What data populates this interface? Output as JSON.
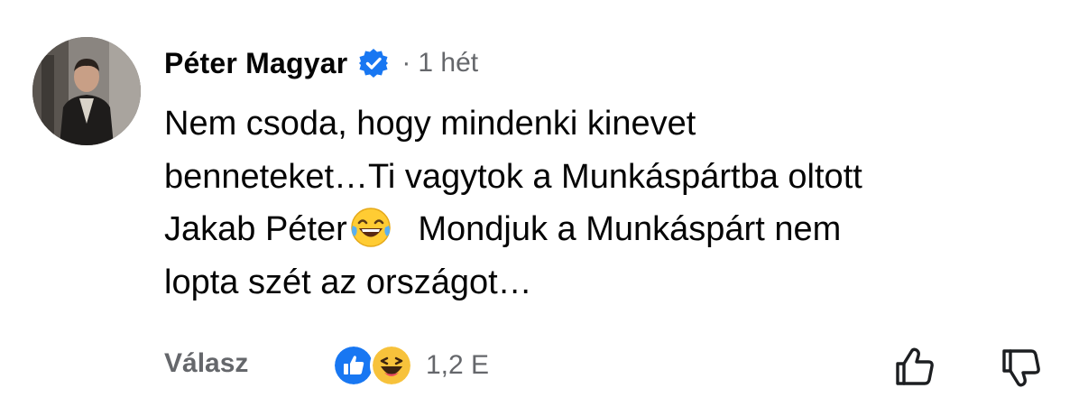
{
  "comment": {
    "author": "Péter Magyar",
    "time_separator": "·",
    "time": "1 hét",
    "text_lines": [
      "Nem csoda, hogy mindenki kinevet",
      "benneteket…Ti vagytok a Munkáspártba oltott",
      "Jakab Péter",
      " Mondjuk a Munkáspárt nem",
      "lopta szét az országot…"
    ],
    "inline_emoji": "face-with-tears-of-joy",
    "reply_label": "Válasz",
    "reaction_icons": [
      "like-reaction",
      "haha-reaction"
    ],
    "reaction_count": "1,2 E"
  },
  "colors": {
    "accent_blue": "#1877f2",
    "muted_text": "#65676b",
    "primary_text": "#050505"
  }
}
